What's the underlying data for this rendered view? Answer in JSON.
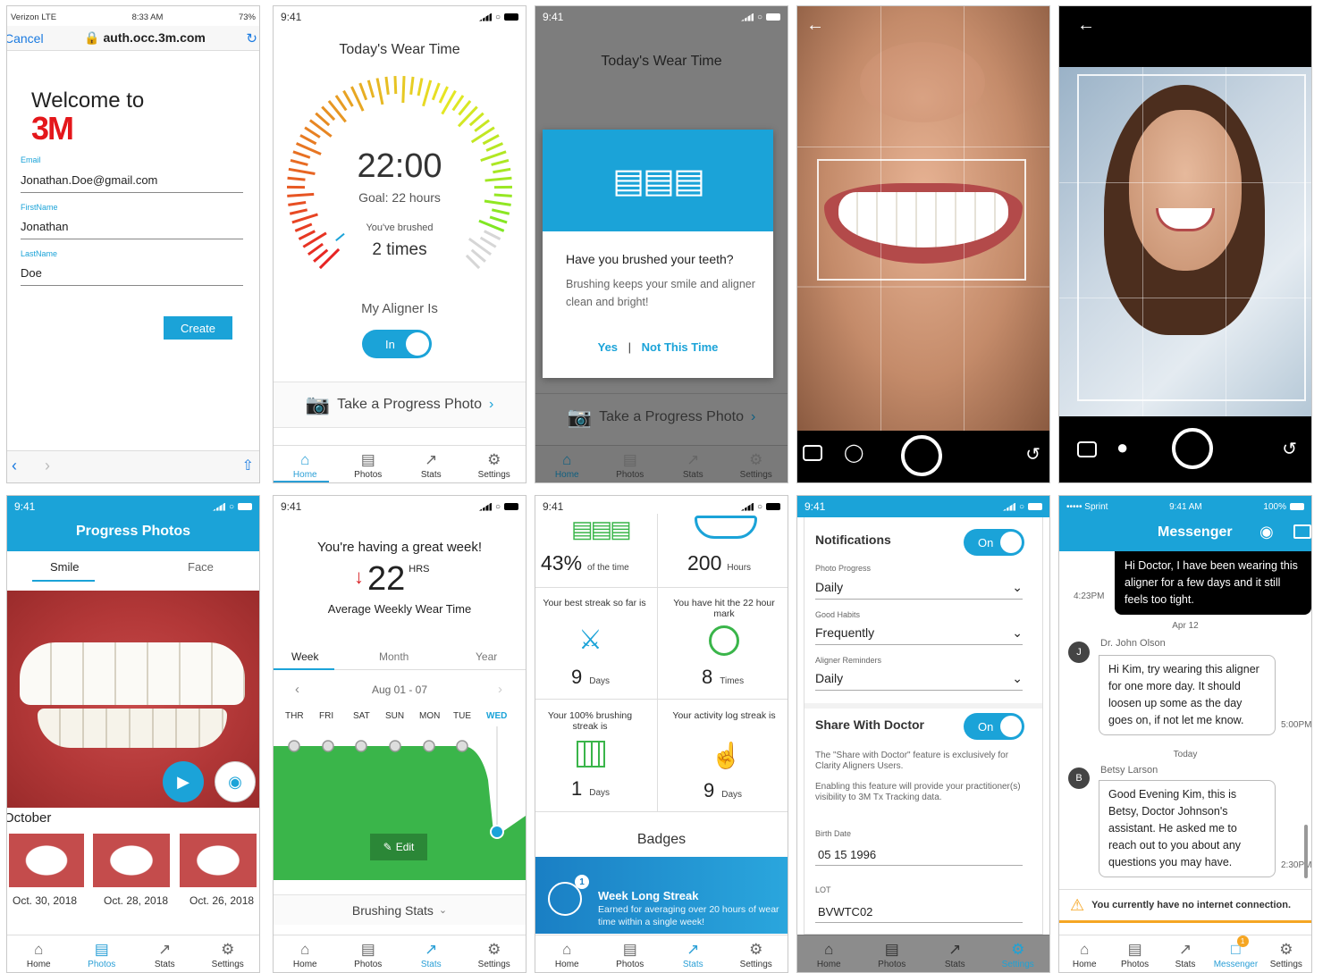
{
  "s1": {
    "carrier": "Verizon  LTE",
    "time": "8:33 AM",
    "battery": "73%",
    "cancel": "Cancel",
    "url": "auth.occ.3m.com",
    "welcome": "Welcome to",
    "logo": "3M",
    "email_label": "Email",
    "email": "Jonathan.Doe@gmail.com",
    "first_label": "FirstName",
    "first": "Jonathan",
    "last_label": "LastName",
    "last": "Doe",
    "create": "Create"
  },
  "s2": {
    "time": "9:41",
    "title": "Today's Wear Time",
    "wear": "22:00",
    "goal": "Goal: 22 hours",
    "brushed_label": "You've brushed",
    "brushed": "2 times",
    "aligner_label": "My Aligner Is",
    "toggle": "In",
    "progress_photo": "Take a Progress Photo"
  },
  "s3": {
    "time": "9:41",
    "title": "Today's Wear Time",
    "question": "Have you brushed your teeth?",
    "body": "Brushing keeps your smile and aligner clean and bright!",
    "yes": "Yes",
    "sep": "|",
    "no": "Not This Time",
    "progress_photo": "Take a Progress Photo"
  },
  "s6": {
    "time": "9:41",
    "title": "Progress Photos",
    "tab_smile": "Smile",
    "tab_face": "Face",
    "month": "October",
    "thumbs": [
      "Oct. 30, 2018",
      "Oct. 28, 2018",
      "Oct. 26, 2018"
    ]
  },
  "s7": {
    "time": "9:41",
    "headline": "You're having a great week!",
    "value": "22",
    "unit": "HRS",
    "subtitle": "Average Weekly Wear Time",
    "tabs": [
      "Week",
      "Month",
      "Year"
    ],
    "range": "Aug 01 - 07",
    "days": [
      "THR",
      "FRI",
      "SAT",
      "SUN",
      "MON",
      "TUE",
      "WED"
    ],
    "edit": "Edit",
    "brushing": "Brushing Stats"
  },
  "s8": {
    "time": "9:41",
    "pct": "43%",
    "pct_label": "of the time",
    "hours": "200",
    "hours_label": "Hours",
    "streak_text": "Your best streak so far is",
    "streak_val": "9",
    "streak_unit": "Days",
    "mark_text": "You have hit the 22 hour mark",
    "mark_val": "8",
    "mark_unit": "Times",
    "brush_text": "Your 100% brushing streak is",
    "brush_val": "1",
    "brush_unit": "Days",
    "log_text": "Your activity log streak is",
    "log_val": "9",
    "log_unit": "Days",
    "badges": "Badges",
    "badge_title": "Week Long Streak",
    "badge_desc": "Earned for averaging over 20 hours of wear time within a single week!",
    "badge_count": "1"
  },
  "s9": {
    "time": "9:41",
    "notifications": "Notifications",
    "on": "On",
    "photo_label": "Photo Progress",
    "photo_val": "Daily",
    "habits_label": "Good Habits",
    "habits_val": "Frequently",
    "remind_label": "Aligner Reminders",
    "remind_val": "Daily",
    "share": "Share With Doctor",
    "share_desc1": "The \"Share with Doctor\" feature is exclusively for Clarity Aligners Users.",
    "share_desc2": "Enabling this feature will provide your practitioner(s) visibility to 3M Tx Tracking data.",
    "birth_label": "Birth Date",
    "birth": "05 15 1996",
    "lot_label": "LOT",
    "lot": "BVWTC02"
  },
  "s10": {
    "carrier": "Sprint",
    "time": "9:41 AM",
    "battery": "100%",
    "title": "Messenger",
    "msg1": "Hi Doctor, I have been wearing this aligner for a few days and it still feels too tight.",
    "msg1_time": "4:23PM",
    "date1": "Apr 12",
    "doc_name": "Dr. John Olson",
    "doc_init": "J",
    "msg2": "Hi Kim, try wearing this aligner for one more day. It should loosen up some as the day goes on, if not let me know.",
    "msg2_time": "5:00PM",
    "date2": "Today",
    "asst_name": "Betsy Larson",
    "asst_init": "B",
    "msg3": "Good Evening Kim, this is Betsy, Doctor Johnson's assistant. He asked me to reach out to you about any questions you may have.",
    "msg3_time": "2:30PM",
    "offline": "You currently have no internet connection.",
    "badge": "1"
  },
  "tabs": {
    "home": "Home",
    "photos": "Photos",
    "stats": "Stats",
    "settings": "Settings",
    "messenger": "Messenger"
  },
  "colors": {
    "accent": "#1ba3d8",
    "green": "#3ab54a",
    "red3m": "#e4171b"
  }
}
